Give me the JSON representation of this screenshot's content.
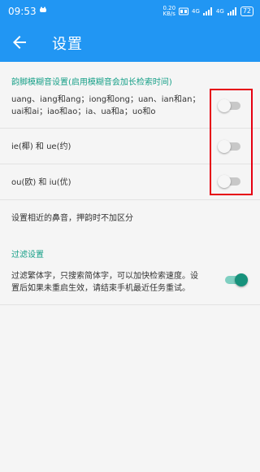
{
  "status_bar": {
    "time": "09:53",
    "speed_value": "0.20",
    "speed_unit": "KB/s",
    "network1": "4G",
    "network2": "4G",
    "battery": "72"
  },
  "app_bar": {
    "title": "设置"
  },
  "fuzzy_section": {
    "header": "韵脚模糊音设置(启用模糊音会加长检索时间)",
    "items": [
      {
        "line1": "uang、iang和ang；iong和ong；uan、ian和an；",
        "line2": "uai和ai；iao和ao；ia、ua和a；uo和o",
        "enabled": false
      },
      {
        "line1": "ie(椰) 和 ue(约)",
        "enabled": false
      },
      {
        "line1": "ou(欧) 和 iu(优)",
        "enabled": false
      }
    ],
    "note": "设置相近的鼻音，押韵时不加区分"
  },
  "filter_section": {
    "header": "过滤设置",
    "line1": "过滤繁体字，只搜索简体字，可以加快检索速度。设",
    "line2": "置后如果未重启生效，请结束手机最近任务重试。",
    "enabled": true
  },
  "colors": {
    "primary": "#2196f3",
    "accent": "#17a088",
    "highlight": "#e60012"
  }
}
